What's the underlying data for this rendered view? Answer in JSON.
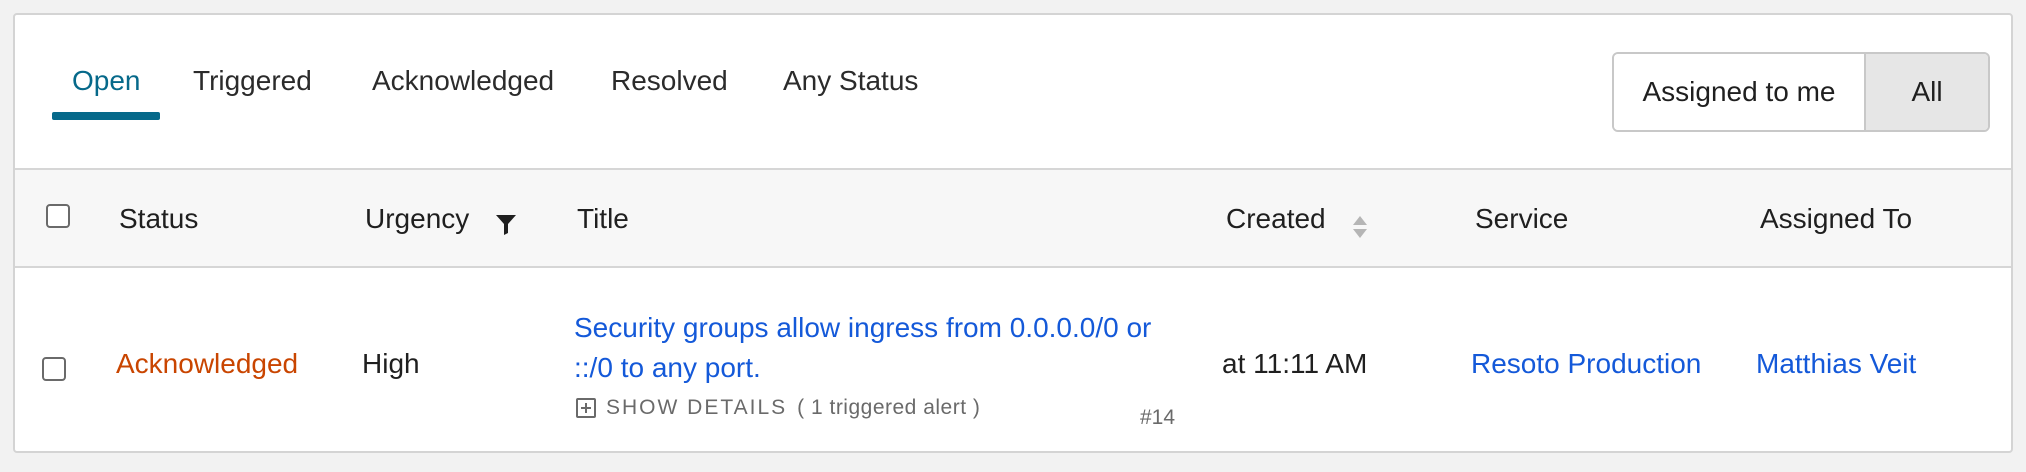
{
  "tabs": [
    {
      "label": "Open",
      "active": true
    },
    {
      "label": "Triggered",
      "active": false
    },
    {
      "label": "Acknowledged",
      "active": false
    },
    {
      "label": "Resolved",
      "active": false
    },
    {
      "label": "Any Status",
      "active": false
    }
  ],
  "assignment_toggle": {
    "assigned_to_me": "Assigned to me",
    "all": "All",
    "selected": "All"
  },
  "table": {
    "columns": [
      "Status",
      "Urgency",
      "Title",
      "Created",
      "Service",
      "Assigned To"
    ],
    "rows": [
      {
        "status": "Acknowledged",
        "urgency": "High",
        "title": "Security groups allow ingress from 0.0.0.0/0 or ::/0 to any port.",
        "show_details": "SHOW DETAILS",
        "alert_count": "( 1 triggered alert )",
        "incident_number": "#14",
        "created": "at 11:11 AM",
        "service": "Resoto Production",
        "assigned_to": "Matthias Veit"
      }
    ]
  },
  "icons": {
    "urgency_filter": "filter-icon",
    "created_sort": "sort-icon",
    "details_expand": "plus-square-icon"
  },
  "colors": {
    "accent": "#06698a",
    "link": "#1459d9",
    "status_acknowledged": "#c94500"
  }
}
